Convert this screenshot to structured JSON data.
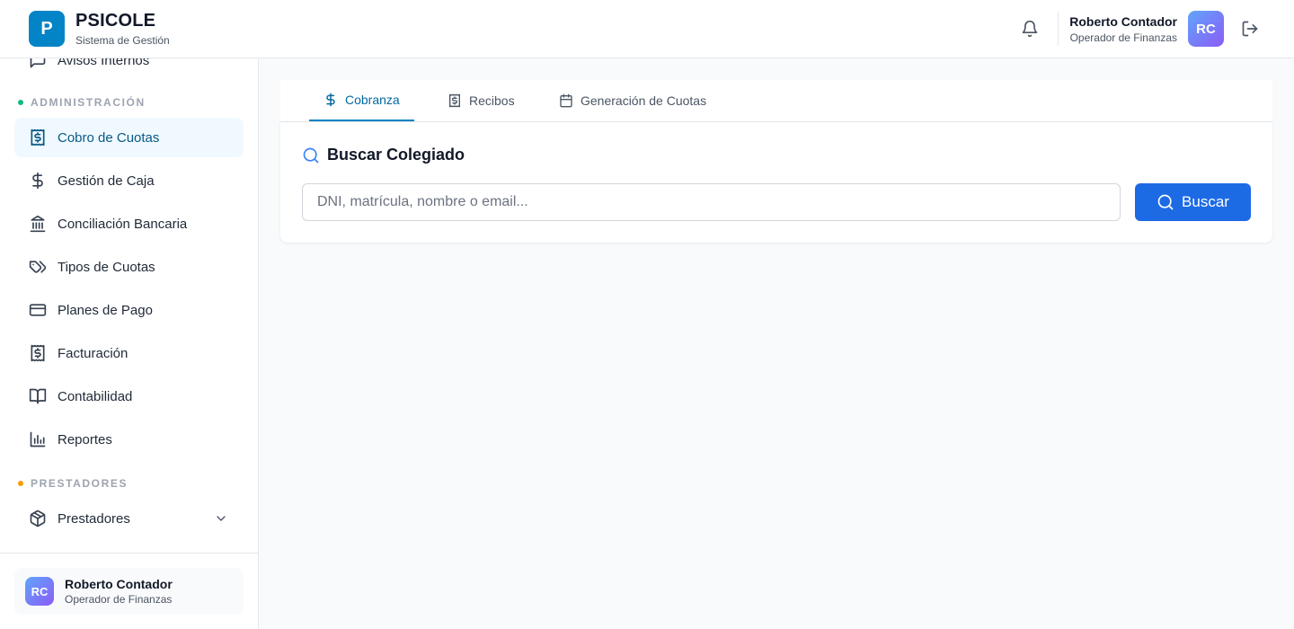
{
  "app": {
    "logo_letter": "P",
    "name": "PSICOLE",
    "subtitle": "Sistema de Gestión"
  },
  "header": {
    "notifications_icon": "bell-icon",
    "user": {
      "name": "Roberto Contador",
      "role": "Operador de Finanzas",
      "initials": "RC"
    },
    "logout_icon": "logout-icon"
  },
  "sidebar": {
    "partial_item": {
      "label": "Avisos Internos",
      "icon": "message-icon"
    },
    "sections": [
      {
        "label": "ADMINISTRACIÓN",
        "color": "#10b981"
      },
      {
        "label": "PRESTADORES",
        "color": "#f59e0b"
      }
    ],
    "items": [
      {
        "label": "Cobro de Cuotas",
        "icon": "receipt-dollar-icon",
        "active": true
      },
      {
        "label": "Gestión de Caja",
        "icon": "dollar-icon"
      },
      {
        "label": "Conciliación Bancaria",
        "icon": "bank-icon"
      },
      {
        "label": "Tipos de Cuotas",
        "icon": "tags-icon"
      },
      {
        "label": "Planes de Pago",
        "icon": "credit-card-icon"
      },
      {
        "label": "Facturación",
        "icon": "receipt-icon"
      },
      {
        "label": "Contabilidad",
        "icon": "book-icon"
      },
      {
        "label": "Reportes",
        "icon": "bar-chart-icon"
      },
      {
        "label": "Prestadores",
        "icon": "package-icon",
        "expandable": true
      }
    ],
    "user": {
      "name": "Roberto Contador",
      "role": "Operador de Finanzas",
      "initials": "RC"
    }
  },
  "main": {
    "tabs": [
      {
        "label": "Cobranza",
        "icon": "dollar-icon",
        "active": true
      },
      {
        "label": "Recibos",
        "icon": "receipt-icon"
      },
      {
        "label": "Generación de Cuotas",
        "icon": "calendar-icon"
      }
    ],
    "search": {
      "title": "Buscar Colegiado",
      "placeholder": "DNI, matrícula, nombre o email...",
      "value": "",
      "button_label": "Buscar"
    }
  },
  "colors": {
    "accent": "#0284c7",
    "primary_button": "#1d6ae5",
    "active_bg": "#f0f9ff"
  }
}
